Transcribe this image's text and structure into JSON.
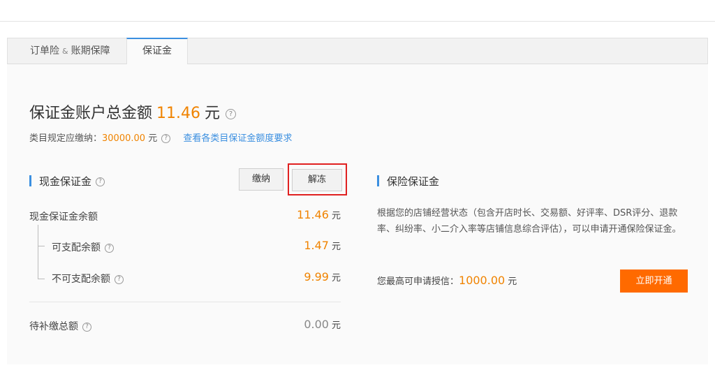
{
  "tabs": [
    {
      "label_a": "订单险",
      "label_sep": "&",
      "label_b": "账期保障"
    },
    {
      "label": "保证金"
    }
  ],
  "account": {
    "title": "保证金账户总金额",
    "amount": "11.46",
    "unit": "元",
    "required_label": "类目规定应缴纳：",
    "required_amount": "30000.00",
    "required_unit": "元",
    "link": "查看各类目保证金额度要求"
  },
  "cash": {
    "title": "现金保证金",
    "pay_button": "缴纳",
    "unfreeze_button": "解冻",
    "balance_label": "现金保证金余额",
    "balance_value": "11.46",
    "available_label": "可支配余额",
    "available_value": "1.47",
    "unavailable_label": "不可支配余额",
    "unavailable_value": "9.99",
    "pending_label": "待补缴总额",
    "pending_value": "0.00",
    "unit": "元"
  },
  "insurance": {
    "title": "保险保证金",
    "description": "根据您的店铺经营状态（包含开店时长、交易额、好评率、DSR评分、退款率、纠纷率、小二介入率等店铺信息综合评估），可以申请开通保险保证金。",
    "limit_label": "您最高可申请授信：",
    "limit_value": "1000.00",
    "limit_unit": "元",
    "open_button": "立即开通"
  },
  "colors": {
    "accent": "#3b8fe0",
    "amount": "#f08300",
    "primary_button": "#ff6a00",
    "highlight": "#e02020"
  },
  "icons": {
    "help": "?"
  }
}
